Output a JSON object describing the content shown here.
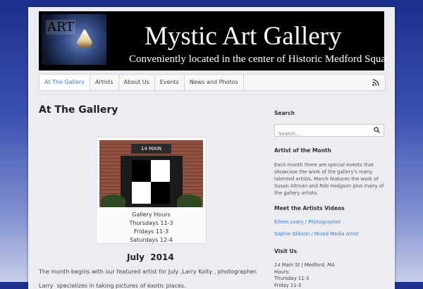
{
  "site": {
    "title": "Mystic Art Gallery",
    "subtitle": "Conveniently located in the center of Historic Medford Square",
    "logo_text": "ART"
  },
  "nav": {
    "items": [
      "At The Gallery",
      "Artists",
      "About Us",
      "Events",
      "News and Photos"
    ],
    "active_index": 0,
    "rss_icon": "rss-icon"
  },
  "main": {
    "title": "At The Gallery",
    "photo": {
      "sign_text": "14 MAIN",
      "caption_lines": [
        "Gallery Hours",
        "Thursdays 11-3",
        "Fridays 11-3",
        "Saturdays 12-4"
      ]
    },
    "month_heading": "July  2014",
    "paragraph1": "The month begins with our featured artist for July ,Larry Kolty , photographer.",
    "paragraph2": "Larry  specializes in taking pictures of exotic places."
  },
  "sidebar": {
    "search_heading": "Search",
    "search_placeholder": "Search...",
    "artist_month_heading": "Artist of the Month",
    "artist_month_text": [
      "Each month there are special events that",
      "showcase the work of the gallery's many",
      "talented artists. March features the work of",
      "Susan Altman and Rob Hodgson plus many of",
      "the gallery artists."
    ],
    "videos_heading": "Meet the Artists Videos",
    "video_links": [
      "Eileen Leary / Photographer",
      "Sophie Glikson / Mixed Media Artist"
    ],
    "visit_heading": "Visit Us",
    "visit_lines": [
      "14 Main St | Medford, MA",
      "Hours:",
      "Thursday 11-3",
      "Friday 11-3"
    ]
  },
  "colors": {
    "link": "#3a7fd0",
    "banner_bg": "#000000",
    "page_bg": "#ececf3"
  }
}
